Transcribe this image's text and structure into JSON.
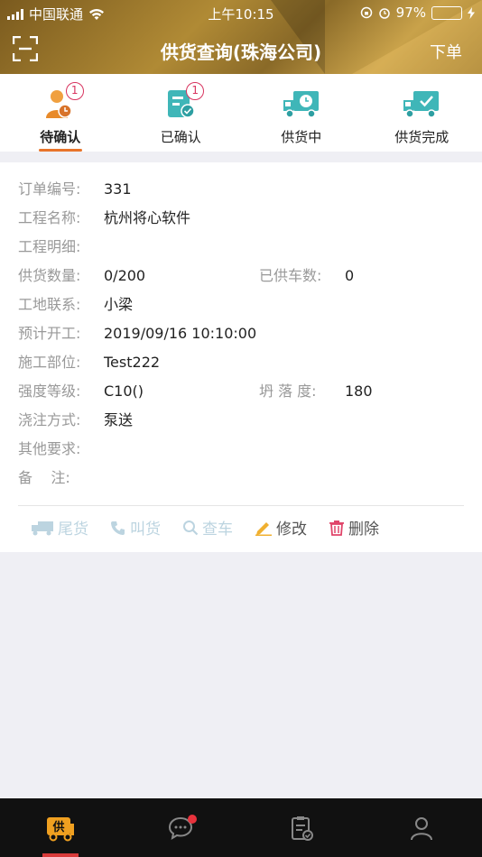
{
  "status_bar": {
    "carrier": "中国联通",
    "time": "上午10:15",
    "battery": "97%",
    "battery_level": 0.97
  },
  "header": {
    "title": "供货查询(珠海公司)",
    "action_label": "下单",
    "scan_icon": "scan-icon"
  },
  "tabs": [
    {
      "label": "待确认",
      "badge": "1",
      "icon": "pending-user-icon",
      "active": true
    },
    {
      "label": "已确认",
      "badge": "1",
      "icon": "confirmed-doc-icon",
      "active": false
    },
    {
      "label": "供货中",
      "badge": "",
      "icon": "truck-clock-icon",
      "active": false
    },
    {
      "label": "供货完成",
      "badge": "",
      "icon": "truck-check-icon",
      "active": false
    }
  ],
  "order": {
    "order_no_label": "订单编号:",
    "order_no": "331",
    "project_name_label": "工程名称:",
    "project_name": "杭州将心软件",
    "project_detail_label": "工程明细:",
    "project_detail": "",
    "supply_qty_label": "供货数量:",
    "supply_qty": "0/200",
    "trucks_label": "已供车数:",
    "trucks": "0",
    "contact_label": "工地联系:",
    "contact": "小梁",
    "planned_start_label": "预计开工:",
    "planned_start": "2019/09/16 10:10:00",
    "position_label": "施工部位:",
    "position": "Test222",
    "strength_label": "强度等级:",
    "strength": "C10()",
    "slump_label": "坍 落 度:",
    "slump": "180",
    "pour_method_label": "浇注方式:",
    "pour_method": "泵送",
    "other_label": "其他要求:",
    "other": "",
    "remark_label": "备    注:",
    "remark": ""
  },
  "actions": {
    "tail": "尾货",
    "call": "叫货",
    "check_truck": "查车",
    "edit": "修改",
    "delete": "删除"
  },
  "bottom_nav": {
    "items": [
      "supply-icon",
      "message-icon",
      "task-icon",
      "profile-icon"
    ],
    "supply_glyph": "供"
  },
  "colors": {
    "accent": "#e8742a",
    "teal": "#3fb6b8",
    "badge": "#d8345f",
    "nav_bg": "#111111"
  }
}
